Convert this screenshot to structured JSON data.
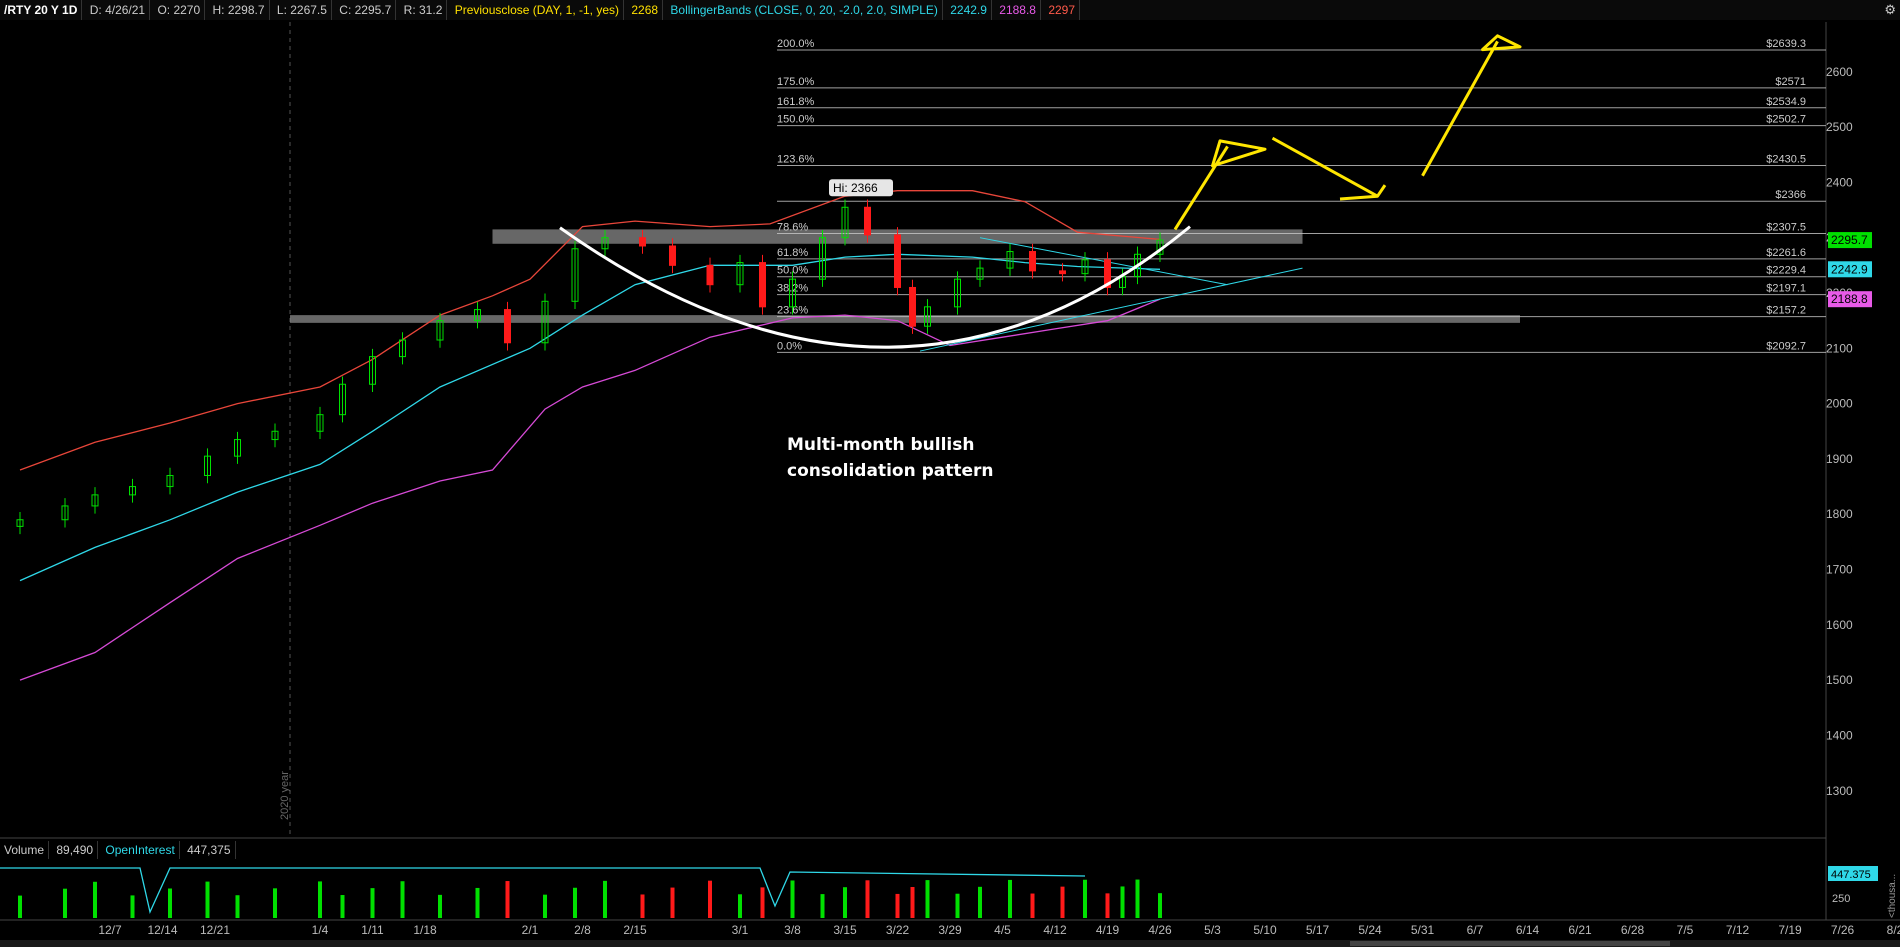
{
  "header": {
    "symbol": "/RTY 20 Y 1D",
    "date": "D: 4/26/21",
    "open": "O: 2270",
    "high": "H: 2298.7",
    "low": "L: 2267.5",
    "close": "C: 2295.7",
    "range": "R: 31.2",
    "prevclose_label": "Previousclose (DAY, 1, -1, yes)",
    "prevclose_value": "2268",
    "bb_label": "BollingerBands (CLOSE, 0, 20, -2.0, 2.0, SIMPLE)",
    "bb_mid": "2242.9",
    "bb_lower": "2188.8",
    "bb_upper": "2297"
  },
  "volume_header": {
    "volume_label": "Volume",
    "volume_value": "89,490",
    "oi_label": "OpenInterest",
    "oi_value": "447,375"
  },
  "annotation": {
    "line1": "Multi-month bullish",
    "line2": "consolidation pattern"
  },
  "year_marker": "2020 year",
  "hi_label": "Hi: 2366",
  "colors": {
    "up": "#00e000",
    "down": "#ff1a1a",
    "bb_upper": "#e8463a",
    "bb_mid": "#2fd8e8",
    "bb_lower": "#d64ad6",
    "fib": "#c8c8c8",
    "zone": "#8a8a8a",
    "annotation_yellow": "#ffe600",
    "cup": "#ffffff",
    "oi": "#2fd8e8"
  },
  "chart_data": {
    "type": "candlestick",
    "ylim": [
      1220,
      2690
    ],
    "y_ticks": [
      1300,
      1400,
      1500,
      1600,
      1700,
      1800,
      1900,
      2000,
      2100,
      2200,
      2300,
      2400,
      2500,
      2600
    ],
    "x_labels": [
      "12/7",
      "12/14",
      "12/21",
      "1/4",
      "1/11",
      "1/18",
      "2/1",
      "2/8",
      "2/15",
      "3/1",
      "3/8",
      "3/15",
      "3/22",
      "3/29",
      "4/5",
      "4/12",
      "4/19",
      "4/26",
      "5/3",
      "5/10",
      "5/17",
      "5/24",
      "5/31",
      "6/7",
      "6/14",
      "6/21",
      "6/28",
      "7/5",
      "7/12",
      "7/19",
      "7/26",
      "8/2"
    ],
    "price_badges": [
      {
        "label": "2295.7",
        "value": 2295.7,
        "color": "#00e000",
        "text": "#000"
      },
      {
        "label": "2242.9",
        "value": 2242.9,
        "color": "#2fd8e8",
        "text": "#000"
      },
      {
        "label": "2188.8",
        "value": 2188.8,
        "color": "#e85ae8",
        "text": "#000"
      }
    ],
    "fib_levels": [
      {
        "pct": "200.0%",
        "price": "$2639.3",
        "value": 2639.3
      },
      {
        "pct": "175.0%",
        "price": "$2571",
        "value": 2571
      },
      {
        "pct": "161.8%",
        "price": "$2534.9",
        "value": 2534.9
      },
      {
        "pct": "150.0%",
        "price": "$2502.7",
        "value": 2502.7
      },
      {
        "pct": "123.6%",
        "price": "$2430.5",
        "value": 2430.5
      },
      {
        "pct": "",
        "price": "$2366",
        "value": 2366
      },
      {
        "pct": "78.6%",
        "price": "$2307.5",
        "value": 2307.5
      },
      {
        "pct": "61.8%",
        "price": "$2261.6",
        "value": 2261.6
      },
      {
        "pct": "50.0%",
        "price": "$2229.4",
        "value": 2229.4
      },
      {
        "pct": "38.2%",
        "price": "$2197.1",
        "value": 2197.1
      },
      {
        "pct": "23.6%",
        "price": "$2157.2",
        "value": 2157.2
      },
      {
        "pct": "0.0%",
        "price": "$2092.7",
        "value": 2092.7
      }
    ],
    "zones": [
      {
        "low": 2289,
        "high": 2315,
        "start_date": "2021-01-27",
        "end_date": "2021-05-15"
      },
      {
        "low": 2146,
        "high": 2160,
        "start_date": "2020-12-31",
        "end_date": "2021-06-13"
      }
    ],
    "volume_scale": {
      "max": 300,
      "tick": "250",
      "oi_badge": "447.375",
      "unit_label": "<thousa..."
    },
    "series": [
      {
        "name": "close",
        "points": [
          [
            "2020-11-25",
            1790
          ],
          [
            "2020-12-01",
            1815
          ],
          [
            "2020-12-05",
            1835
          ],
          [
            "2020-12-10",
            1850
          ],
          [
            "2020-12-15",
            1870
          ],
          [
            "2020-12-20",
            1905
          ],
          [
            "2020-12-24",
            1935
          ],
          [
            "2020-12-29",
            1950
          ],
          [
            "2021-01-04",
            1980
          ],
          [
            "2021-01-07",
            2035
          ],
          [
            "2021-01-11",
            2085
          ],
          [
            "2021-01-15",
            2115
          ],
          [
            "2021-01-20",
            2150
          ],
          [
            "2021-01-25",
            2170
          ],
          [
            "2021-01-29",
            2110
          ],
          [
            "2021-02-03",
            2185
          ],
          [
            "2021-02-07",
            2280
          ],
          [
            "2021-02-11",
            2300
          ],
          [
            "2021-02-16",
            2285
          ],
          [
            "2021-02-20",
            2250
          ],
          [
            "2021-02-25",
            2215
          ],
          [
            "2021-03-01",
            2255
          ],
          [
            "2021-03-04",
            2175
          ],
          [
            "2021-03-08",
            2225
          ],
          [
            "2021-03-12",
            2300
          ],
          [
            "2021-03-15",
            2355
          ],
          [
            "2021-03-18",
            2305
          ],
          [
            "2021-03-22",
            2210
          ],
          [
            "2021-03-24",
            2140
          ],
          [
            "2021-03-26",
            2175
          ],
          [
            "2021-03-30",
            2225
          ],
          [
            "2021-04-02",
            2245
          ],
          [
            "2021-04-06",
            2275
          ],
          [
            "2021-04-09",
            2240
          ],
          [
            "2021-04-13",
            2235
          ],
          [
            "2021-04-16",
            2260
          ],
          [
            "2021-04-19",
            2210
          ],
          [
            "2021-04-21",
            2230
          ],
          [
            "2021-04-23",
            2270
          ],
          [
            "2021-04-26",
            2295.7
          ]
        ]
      },
      {
        "name": "bb_upper",
        "points": [
          [
            "2020-11-25",
            1880
          ],
          [
            "2020-12-05",
            1930
          ],
          [
            "2020-12-15",
            1965
          ],
          [
            "2020-12-24",
            2000
          ],
          [
            "2021-01-04",
            2030
          ],
          [
            "2021-01-11",
            2080
          ],
          [
            "2021-01-20",
            2160
          ],
          [
            "2021-01-27",
            2195
          ],
          [
            "2021-02-01",
            2225
          ],
          [
            "2021-02-08",
            2320
          ],
          [
            "2021-02-15",
            2330
          ],
          [
            "2021-02-25",
            2320
          ],
          [
            "2021-03-05",
            2325
          ],
          [
            "2021-03-15",
            2375
          ],
          [
            "2021-03-22",
            2385
          ],
          [
            "2021-04-01",
            2385
          ],
          [
            "2021-04-08",
            2365
          ],
          [
            "2021-04-15",
            2310
          ],
          [
            "2021-04-26",
            2297
          ]
        ]
      },
      {
        "name": "bb_mid",
        "points": [
          [
            "2020-11-25",
            1680
          ],
          [
            "2020-12-05",
            1740
          ],
          [
            "2020-12-15",
            1790
          ],
          [
            "2020-12-24",
            1840
          ],
          [
            "2021-01-04",
            1890
          ],
          [
            "2021-01-11",
            1950
          ],
          [
            "2021-01-20",
            2030
          ],
          [
            "2021-02-01",
            2100
          ],
          [
            "2021-02-08",
            2160
          ],
          [
            "2021-02-15",
            2215
          ],
          [
            "2021-02-25",
            2250
          ],
          [
            "2021-03-08",
            2250
          ],
          [
            "2021-03-15",
            2265
          ],
          [
            "2021-03-22",
            2270
          ],
          [
            "2021-04-01",
            2265
          ],
          [
            "2021-04-08",
            2255
          ],
          [
            "2021-04-15",
            2248
          ],
          [
            "2021-04-26",
            2242.9
          ]
        ]
      },
      {
        "name": "bb_lower",
        "points": [
          [
            "2020-11-25",
            1500
          ],
          [
            "2020-12-05",
            1550
          ],
          [
            "2020-12-15",
            1640
          ],
          [
            "2020-12-24",
            1720
          ],
          [
            "2021-01-04",
            1780
          ],
          [
            "2021-01-11",
            1820
          ],
          [
            "2021-01-20",
            1860
          ],
          [
            "2021-01-27",
            1880
          ],
          [
            "2021-02-03",
            1990
          ],
          [
            "2021-02-08",
            2030
          ],
          [
            "2021-02-15",
            2060
          ],
          [
            "2021-02-25",
            2120
          ],
          [
            "2021-03-08",
            2155
          ],
          [
            "2021-03-15",
            2160
          ],
          [
            "2021-03-22",
            2150
          ],
          [
            "2021-03-29",
            2105
          ],
          [
            "2021-04-05",
            2120
          ],
          [
            "2021-04-12",
            2135
          ],
          [
            "2021-04-19",
            2150
          ],
          [
            "2021-04-26",
            2188.8
          ]
        ]
      }
    ],
    "hi_value": 2366,
    "hi_date": "2021-03-15"
  }
}
